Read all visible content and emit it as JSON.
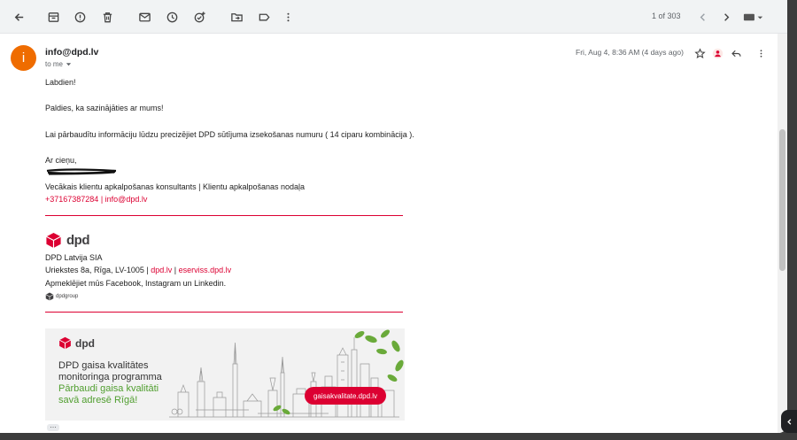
{
  "toolbar": {
    "buttons": [
      "back",
      "archive",
      "report-spam",
      "delete",
      "mark-unread",
      "snooze",
      "add-to-tasks",
      "move-to",
      "labels",
      "more"
    ],
    "pager": "1 of 303"
  },
  "message": {
    "sender_initial": "i",
    "sender": "info@dpd.lv",
    "to": "to me",
    "date": "Fri, Aug 4, 8:36 AM (4 days ago)",
    "avatar_color": "#ef6c00"
  },
  "body": {
    "greeting": "Labdien!",
    "thanks": "Paldies, ka sazinājāties ar mums!",
    "request": "Lai pārbaudītu informāciju lūdzu precizējiet DPD sūtījuma izsekošanas numuru ( 14 ciparu kombinācija ).",
    "closing": "Ar cieņu,",
    "role": "Vecākais klientu apkalpošanas konsultants | Klientu apkalpošanas nodaļa",
    "phone": "+37167387284",
    "separator": " | ",
    "email": "info@dpd.lv"
  },
  "signature": {
    "logo_text": "dpd",
    "company": "DPD Latvija SIA",
    "address": "Uriekstes 8a, Rīga, LV-1005 | ",
    "site1": "dpd.lv",
    "site_sep": " | ",
    "site2": "eserviss.dpd.lv",
    "social": "Apmeklējiet mūs Facebook, Instagram un Linkedin.",
    "group_logo_text": "dpdgroup"
  },
  "banner": {
    "logo_text": "dpd",
    "title_line1": "DPD gaisa kvalitātes",
    "title_line2": "monitoringa programma",
    "green_line1": "Pārbaudi gaisa kvalitāti",
    "green_line2": "savā adresē Rīgā!",
    "button": "gaisakvalitate.dpd.lv"
  },
  "colors": {
    "brand_red": "#dc0032",
    "green": "#509e2f"
  }
}
